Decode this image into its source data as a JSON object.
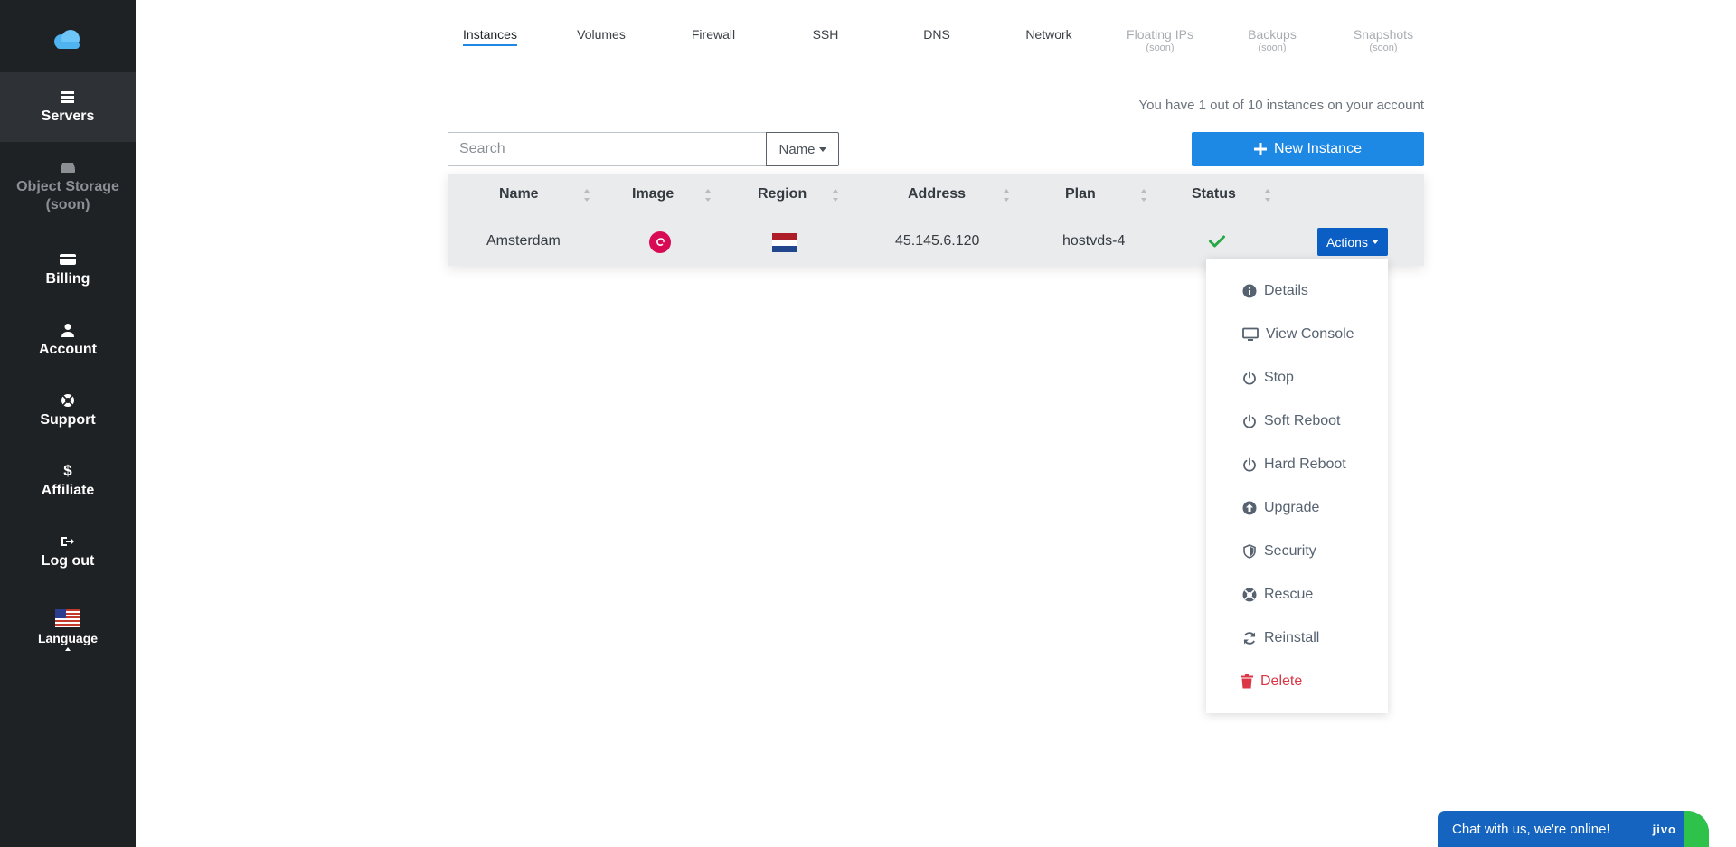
{
  "sidebar": {
    "items": [
      {
        "label": "Servers",
        "icon": "servers-icon"
      },
      {
        "label": "Object Storage",
        "sub": "(soon)",
        "icon": "storage-icon"
      },
      {
        "label": "Billing",
        "icon": "billing-icon"
      },
      {
        "label": "Account",
        "icon": "user-icon"
      },
      {
        "label": "Support",
        "icon": "support-icon"
      },
      {
        "label": "Affiliate",
        "icon": "dollar-icon"
      },
      {
        "label": "Log out",
        "icon": "logout-icon"
      },
      {
        "label": "Language",
        "icon": "us-flag-icon"
      }
    ]
  },
  "tabs": [
    {
      "label": "Instances"
    },
    {
      "label": "Volumes"
    },
    {
      "label": "Firewall"
    },
    {
      "label": "SSH"
    },
    {
      "label": "DNS"
    },
    {
      "label": "Network"
    },
    {
      "label": "Floating IPs",
      "soon": "(soon)"
    },
    {
      "label": "Backups",
      "soon": "(soon)"
    },
    {
      "label": "Snapshots",
      "soon": "(soon)"
    }
  ],
  "main": {
    "instance_count_text": "You have 1 out of 10 instances on your account",
    "search_placeholder": "Search",
    "filter_label": "Name",
    "new_button": "New Instance"
  },
  "table": {
    "headers": [
      "Name",
      "Image",
      "Region",
      "Address",
      "Plan",
      "Status"
    ],
    "rows": [
      {
        "name": "Amsterdam",
        "image": "debian-icon",
        "region": "netherlands-flag-icon",
        "address": "45.145.6.120",
        "plan": "hostvds-4",
        "status": "check-icon"
      }
    ],
    "actions_label": "Actions"
  },
  "actions_menu": [
    {
      "label": "Details",
      "icon": "info-icon"
    },
    {
      "label": "View Console",
      "icon": "monitor-icon"
    },
    {
      "label": "Stop",
      "icon": "power-icon"
    },
    {
      "label": "Soft Reboot",
      "icon": "power-icon"
    },
    {
      "label": "Hard Reboot",
      "icon": "power-icon"
    },
    {
      "label": "Upgrade",
      "icon": "upgrade-icon"
    },
    {
      "label": "Security",
      "icon": "shield-icon"
    },
    {
      "label": "Rescue",
      "icon": "lifebuoy-icon"
    },
    {
      "label": "Reinstall",
      "icon": "refresh-icon"
    },
    {
      "label": "Delete",
      "icon": "trash-icon"
    }
  ],
  "chat": {
    "text": "Chat with us, we're online!",
    "brand": "jivo"
  },
  "colors": {
    "sidebar": "#1f2225",
    "accent": "#1e88e5",
    "actions": "#0b5fc4",
    "danger": "#dc3545",
    "success": "#28a745"
  }
}
